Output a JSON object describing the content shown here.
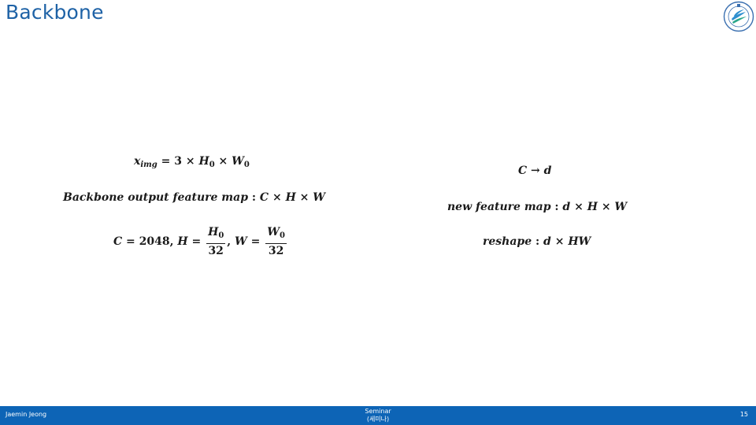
{
  "slide": {
    "title": "Backbone",
    "logo_icon": "university-emblem-icon"
  },
  "formulas": {
    "left": {
      "x_img": {
        "var": "x",
        "sub": "img",
        "rhs_const": "3",
        "h": "H",
        "h_sub": "0",
        "w": "W",
        "w_sub": "0",
        "eq": "=",
        "times": "×"
      },
      "backbone": {
        "label": "Backbone output feature map",
        "colon": ":",
        "c": "C",
        "h": "H",
        "w": "W",
        "times": "×"
      },
      "dims": {
        "c": "C",
        "eq": "=",
        "c_val": "2048",
        "comma": ",",
        "h": "H",
        "h_num": "H",
        "h_num_sub": "0",
        "h_den": "32",
        "w": "W",
        "w_num": "W",
        "w_num_sub": "0",
        "w_den": "32"
      }
    },
    "right": {
      "proj": {
        "from": "C",
        "arrow": "→",
        "to": "d"
      },
      "new_map": {
        "label": "new feature map",
        "colon": ":",
        "d": "d",
        "h": "H",
        "w": "W",
        "times": "×"
      },
      "reshape": {
        "label": "reshape",
        "colon": ":",
        "d": "d",
        "hw": "HW",
        "times": "×"
      }
    }
  },
  "footer": {
    "author": "Jaemin Jeong",
    "center_line1": "Seminar",
    "center_line2": "(세미나)",
    "page": "15",
    "bar_color": "#0d64b6"
  }
}
